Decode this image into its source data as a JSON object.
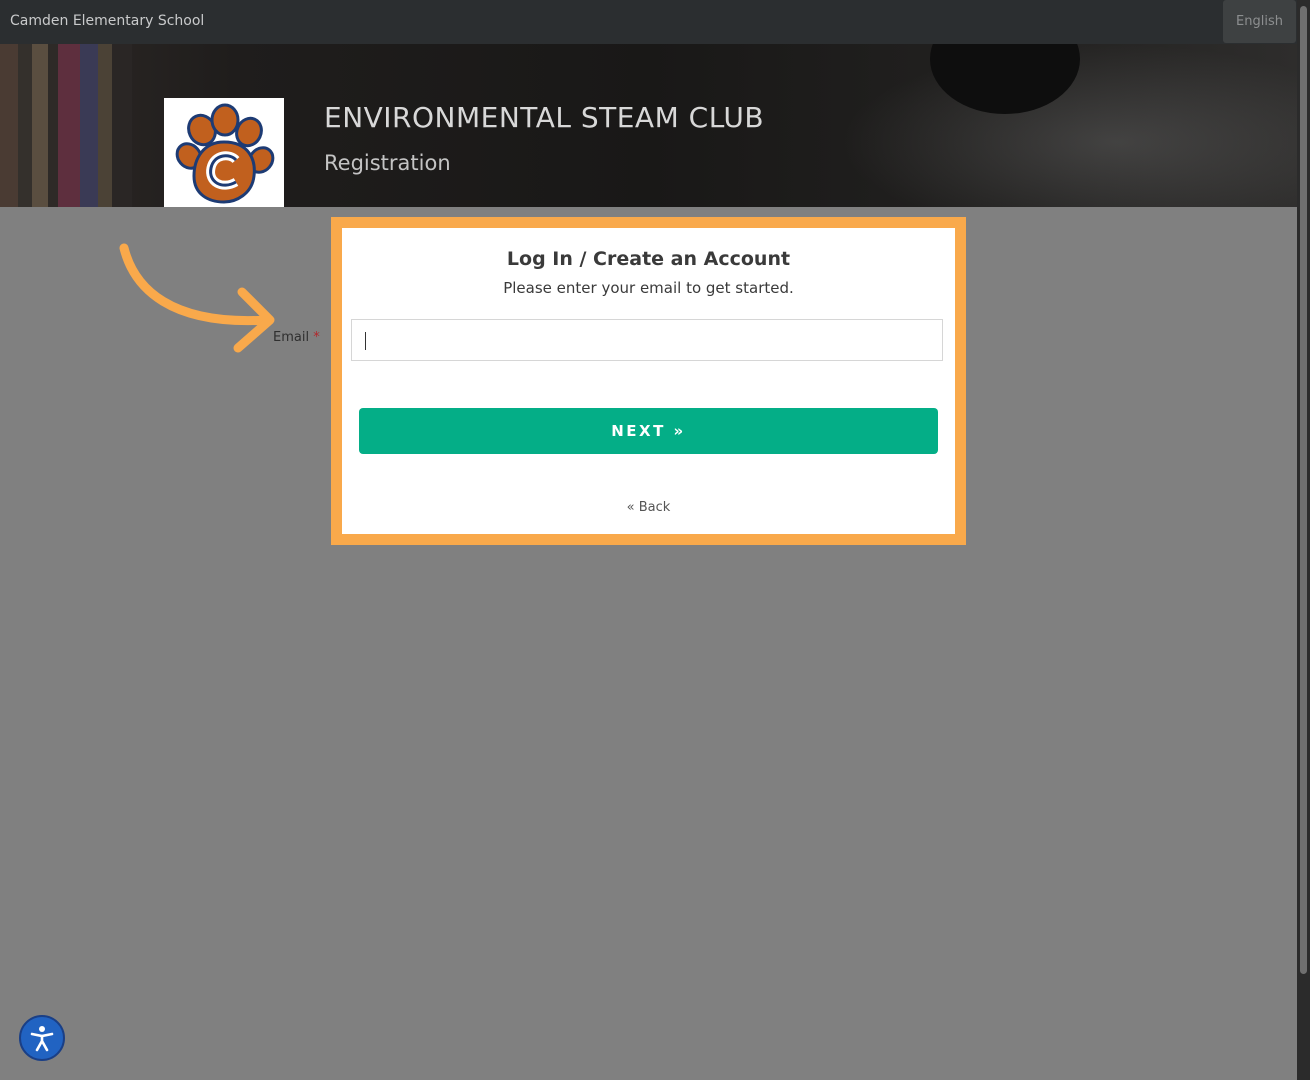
{
  "topbar": {
    "school_name": "Camden Elementary School",
    "language_button": "English"
  },
  "header": {
    "title": "ENVIRONMENTAL STEAM CLUB",
    "subtitle": "Registration",
    "logo_icon": "paw-c-logo-icon"
  },
  "form": {
    "email_label": "Email",
    "required_marker": "*"
  },
  "modal": {
    "title": "Log In / Create an Account",
    "subtitle": "Please enter your email to get started.",
    "email_value": "",
    "email_placeholder": "",
    "next_label": "NEXT »",
    "back_label": "« Back",
    "highlight_color": "#f9a94b",
    "button_color": "#04ae87"
  },
  "accessibility": {
    "icon": "accessibility-person-icon",
    "color": "#2163c2"
  }
}
